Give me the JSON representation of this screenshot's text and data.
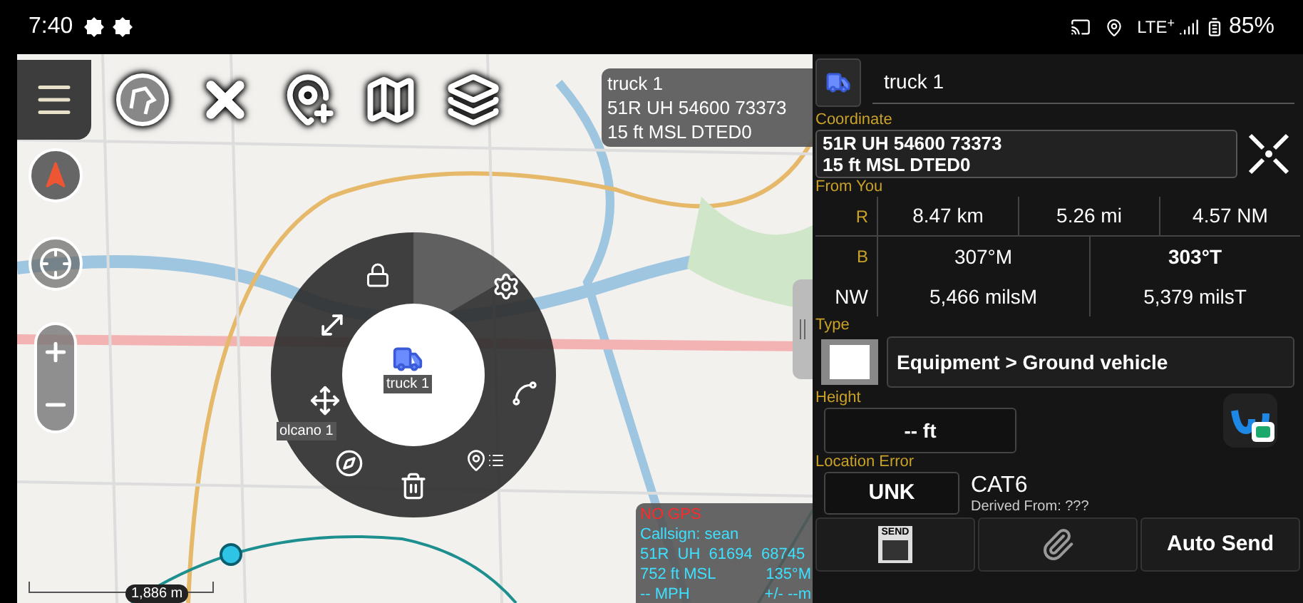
{
  "status_bar": {
    "time": "7:40",
    "network": "LTE$^{+}$",
    "battery": "85%"
  },
  "map": {
    "info_box": [
      "truck 1",
      "51R UH 54600 73373",
      "15 ft MSL DTED0"
    ],
    "markers": [
      {
        "kind": "truck",
        "label": "truck 1"
      },
      {
        "kind": "volcano",
        "label": "olcano 1"
      }
    ],
    "scale": "1,886 m",
    "self_info": {
      "gps": "NO GPS",
      "callsign": "Callsign: sean",
      "coord": "51R  UH  61694  68745",
      "altitude": "752 ft MSL",
      "bearing": "135°M",
      "speed": "-- MPH",
      "error": "+/- --m"
    }
  },
  "panel": {
    "name": "truck 1",
    "coordinate_label": "Coordinate",
    "coordinate": [
      "51R UH 54600 73373",
      "15 ft MSL DTED0"
    ],
    "from_you_label": "From You",
    "range": {
      "label": "R",
      "values": [
        "8.47 km",
        "5.26 mi",
        "4.57 NM"
      ]
    },
    "bearing": {
      "label": "B",
      "values": [
        "307°M",
        "303°T"
      ]
    },
    "mils": {
      "label": "NW",
      "values": [
        "5,466 milsM",
        "5,379 milsT"
      ]
    },
    "type_label": "Type",
    "type": "Equipment > Ground vehicle",
    "height_label": "Height",
    "height": "-- ft",
    "location_error_label": "Location Error",
    "location_error": "UNK",
    "category": "CAT6",
    "derived": "Derived From: ???",
    "buttons": [
      {
        "kind": "send",
        "label": "SEND"
      },
      {
        "kind": "attach"
      },
      {
        "kind": "text",
        "label": "Auto Send"
      }
    ]
  }
}
